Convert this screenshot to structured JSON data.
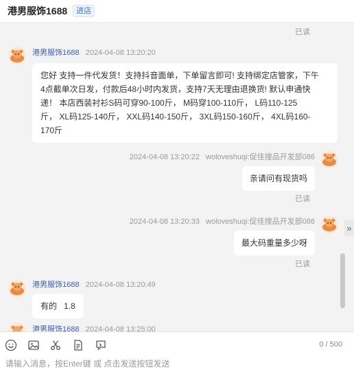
{
  "header": {
    "shop_name": "港男服饰1688",
    "enter_shop": "进店"
  },
  "messages": [
    {
      "type": "status",
      "text": "已读"
    },
    {
      "type": "incoming",
      "sender": "港男服饰1688",
      "time": "2024-04-08 13:20:20",
      "lines": [
        " 您好 支持一件代发货！支持抖音面单，下单留言即可! 支持绑定店管家，下午",
        "4点截单次日发，付款后48小时内发货，支持7天无理由退换货! 默认申通快",
        "递！ 本店西装衬衫S码可穿90-100斤， M码穿100-110斤， L码110-125",
        "斤， XL码125-140斤， XXL码140-150斤， 3XL码150-160斤， 4XL码160-",
        "170斤"
      ]
    },
    {
      "type": "outgoing",
      "time": "2024-04-08 13:20:22",
      "sender": "woloveshuqi:促佳搜品开发部086",
      "text": "亲请问有现货吗",
      "status": "已读"
    },
    {
      "type": "outgoing",
      "time": "2024-04-08 13:20:33",
      "sender": "woloveshuqi:促佳搜品开发部086",
      "text": "最大码重量多少呀",
      "status": "已读"
    },
    {
      "type": "incoming",
      "sender": "港男服饰1688",
      "time": "2024-04-08 13:20:49",
      "text": "有的   1.8"
    },
    {
      "type": "incoming",
      "sender": "港男服饰1688",
      "time": "2024-04-08 13:25:00"
    }
  ],
  "collapse_glyph": "»",
  "toolbar": {
    "icons": [
      "emoji-icon",
      "image-icon",
      "scissors-icon",
      "file-icon",
      "quick-reply-icon"
    ],
    "counter": "0 / 500"
  },
  "input": {
    "placeholder": "请输入消息，按Enter键 或 点击发送按钮发送",
    "value": ""
  },
  "colors": {
    "chat_background": "#f3f3f3",
    "sender_name": "#3a5db8",
    "avatar_primary": "#e98a47"
  }
}
